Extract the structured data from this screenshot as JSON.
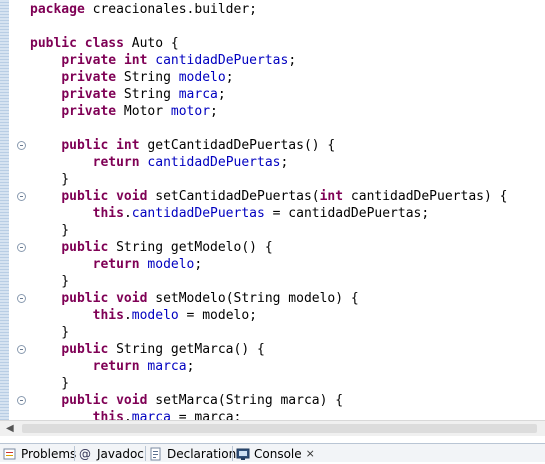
{
  "editor": {
    "lines": [
      [
        {
          "t": "package",
          "c": "kw"
        },
        {
          "t": " creacionales.builder;"
        }
      ],
      [],
      [
        {
          "t": "public",
          "c": "kw"
        },
        {
          "t": " "
        },
        {
          "t": "class",
          "c": "kw"
        },
        {
          "t": " Auto {"
        }
      ],
      [
        {
          "t": "    "
        },
        {
          "t": "private",
          "c": "kw"
        },
        {
          "t": " "
        },
        {
          "t": "int",
          "c": "kw"
        },
        {
          "t": " "
        },
        {
          "t": "cantidadDePuertas",
          "c": "fld"
        },
        {
          "t": ";"
        }
      ],
      [
        {
          "t": "    "
        },
        {
          "t": "private",
          "c": "kw"
        },
        {
          "t": " String "
        },
        {
          "t": "modelo",
          "c": "fld"
        },
        {
          "t": ";"
        }
      ],
      [
        {
          "t": "    "
        },
        {
          "t": "private",
          "c": "kw"
        },
        {
          "t": " String "
        },
        {
          "t": "marca",
          "c": "fld"
        },
        {
          "t": ";"
        }
      ],
      [
        {
          "t": "    "
        },
        {
          "t": "private",
          "c": "kw"
        },
        {
          "t": " Motor "
        },
        {
          "t": "motor",
          "c": "fld"
        },
        {
          "t": ";"
        }
      ],
      [],
      [
        {
          "t": "    "
        },
        {
          "t": "public",
          "c": "kw"
        },
        {
          "t": " "
        },
        {
          "t": "int",
          "c": "kw"
        },
        {
          "t": " getCantidadDePuertas() {"
        }
      ],
      [
        {
          "t": "        "
        },
        {
          "t": "return",
          "c": "kw"
        },
        {
          "t": " "
        },
        {
          "t": "cantidadDePuertas",
          "c": "fld"
        },
        {
          "t": ";"
        }
      ],
      [
        {
          "t": "    }"
        }
      ],
      [
        {
          "t": "    "
        },
        {
          "t": "public",
          "c": "kw"
        },
        {
          "t": " "
        },
        {
          "t": "void",
          "c": "kw"
        },
        {
          "t": " setCantidadDePuertas("
        },
        {
          "t": "int",
          "c": "kw"
        },
        {
          "t": " cantidadDePuertas) {"
        }
      ],
      [
        {
          "t": "        "
        },
        {
          "t": "this",
          "c": "kw"
        },
        {
          "t": "."
        },
        {
          "t": "cantidadDePuertas",
          "c": "fld"
        },
        {
          "t": " = cantidadDePuertas;"
        }
      ],
      [
        {
          "t": "    }"
        }
      ],
      [
        {
          "t": "    "
        },
        {
          "t": "public",
          "c": "kw"
        },
        {
          "t": " String getModelo() {"
        }
      ],
      [
        {
          "t": "        "
        },
        {
          "t": "return",
          "c": "kw"
        },
        {
          "t": " "
        },
        {
          "t": "modelo",
          "c": "fld"
        },
        {
          "t": ";"
        }
      ],
      [
        {
          "t": "    }"
        }
      ],
      [
        {
          "t": "    "
        },
        {
          "t": "public",
          "c": "kw"
        },
        {
          "t": " "
        },
        {
          "t": "void",
          "c": "kw"
        },
        {
          "t": " setModelo(String modelo) {"
        }
      ],
      [
        {
          "t": "        "
        },
        {
          "t": "this",
          "c": "kw"
        },
        {
          "t": "."
        },
        {
          "t": "modelo",
          "c": "fld"
        },
        {
          "t": " = modelo;"
        }
      ],
      [
        {
          "t": "    }"
        }
      ],
      [
        {
          "t": "    "
        },
        {
          "t": "public",
          "c": "kw"
        },
        {
          "t": " String getMarca() {"
        }
      ],
      [
        {
          "t": "        "
        },
        {
          "t": "return",
          "c": "kw"
        },
        {
          "t": " "
        },
        {
          "t": "marca",
          "c": "fld"
        },
        {
          "t": ";"
        }
      ],
      [
        {
          "t": "    }"
        }
      ],
      [
        {
          "t": "    "
        },
        {
          "t": "public",
          "c": "kw"
        },
        {
          "t": " "
        },
        {
          "t": "void",
          "c": "kw"
        },
        {
          "t": " setMarca(String marca) {"
        }
      ],
      [
        {
          "t": "        "
        },
        {
          "t": "this",
          "c": "kw"
        },
        {
          "t": "."
        },
        {
          "t": "marca",
          "c": "fld"
        },
        {
          "t": " = marca;"
        }
      ]
    ],
    "fold_marker_lines": [
      8,
      11,
      14,
      17,
      20,
      23
    ],
    "colors": {
      "keyword": "#7f0055",
      "field": "#0000c0",
      "text": "#000000"
    }
  },
  "tabs": [
    {
      "label": "Problems",
      "icon": "problems-icon",
      "active": false
    },
    {
      "label": "Javadoc",
      "icon": "javadoc-at-icon",
      "active": false
    },
    {
      "label": "Declaration",
      "icon": "declaration-icon",
      "active": false
    },
    {
      "label": "Console",
      "icon": "console-icon",
      "active": true
    }
  ]
}
